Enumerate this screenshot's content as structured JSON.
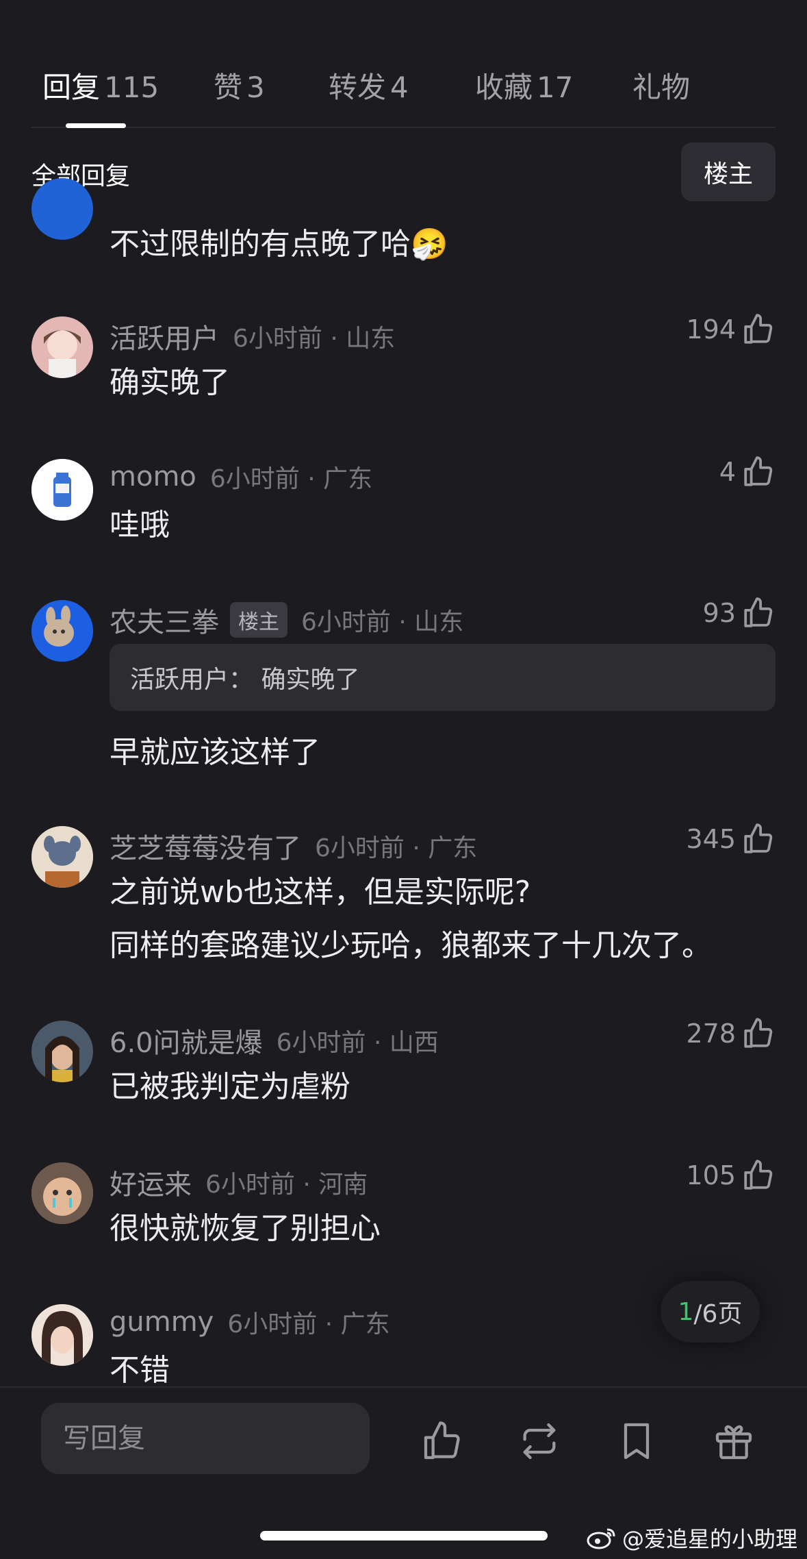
{
  "tabs": [
    {
      "label": "回复",
      "count": "115"
    },
    {
      "label": "赞",
      "count": "3"
    },
    {
      "label": "转发",
      "count": "4"
    },
    {
      "label": "收藏",
      "count": "17"
    },
    {
      "label": "礼物",
      "count": ""
    }
  ],
  "filter": {
    "title": "全部回复",
    "owner_button": "楼主"
  },
  "partial_comment": {
    "text": "不过限制的有点晚了哈",
    "emoji": "🤧"
  },
  "comments": [
    {
      "username": "活跃用户",
      "time": "6小时前 · 山东",
      "likes": "194",
      "text": "确实晚了"
    },
    {
      "username": "momo",
      "time": "6小时前 · 广东",
      "likes": "4",
      "text": "哇哦"
    },
    {
      "username": "农夫三拳",
      "badge": "楼主",
      "time": "6小时前 · 山东",
      "likes": "93",
      "quote": "活跃用户： 确实晚了",
      "text": "早就应该这样了"
    },
    {
      "username": "芝芝莓莓没有了",
      "time": "6小时前 · 广东",
      "likes": "345",
      "text": "之前说wb也这样，但是实际呢?",
      "text2": "同样的套路建议少玩哈，狼都来了十几次了。"
    },
    {
      "username": "6.0问就是爆",
      "time": "6小时前 · 山西",
      "likes": "278",
      "text": "已被我判定为虐粉"
    },
    {
      "username": "好运来",
      "time": "6小时前 · 河南",
      "likes": "105",
      "text": "很快就恢复了别担心"
    },
    {
      "username": "gummy",
      "time": "6小时前 · 广东",
      "likes": "",
      "text": "不错"
    }
  ],
  "pagination": {
    "current": "1",
    "rest": "/6页"
  },
  "bottom_bar": {
    "reply_placeholder": "写回复"
  },
  "watermark": {
    "text": "@爱追星的小助理"
  },
  "colors": {
    "background": "#1c1c20",
    "accent_green": "#3ec46d",
    "muted_text": "#9a9aa0"
  }
}
